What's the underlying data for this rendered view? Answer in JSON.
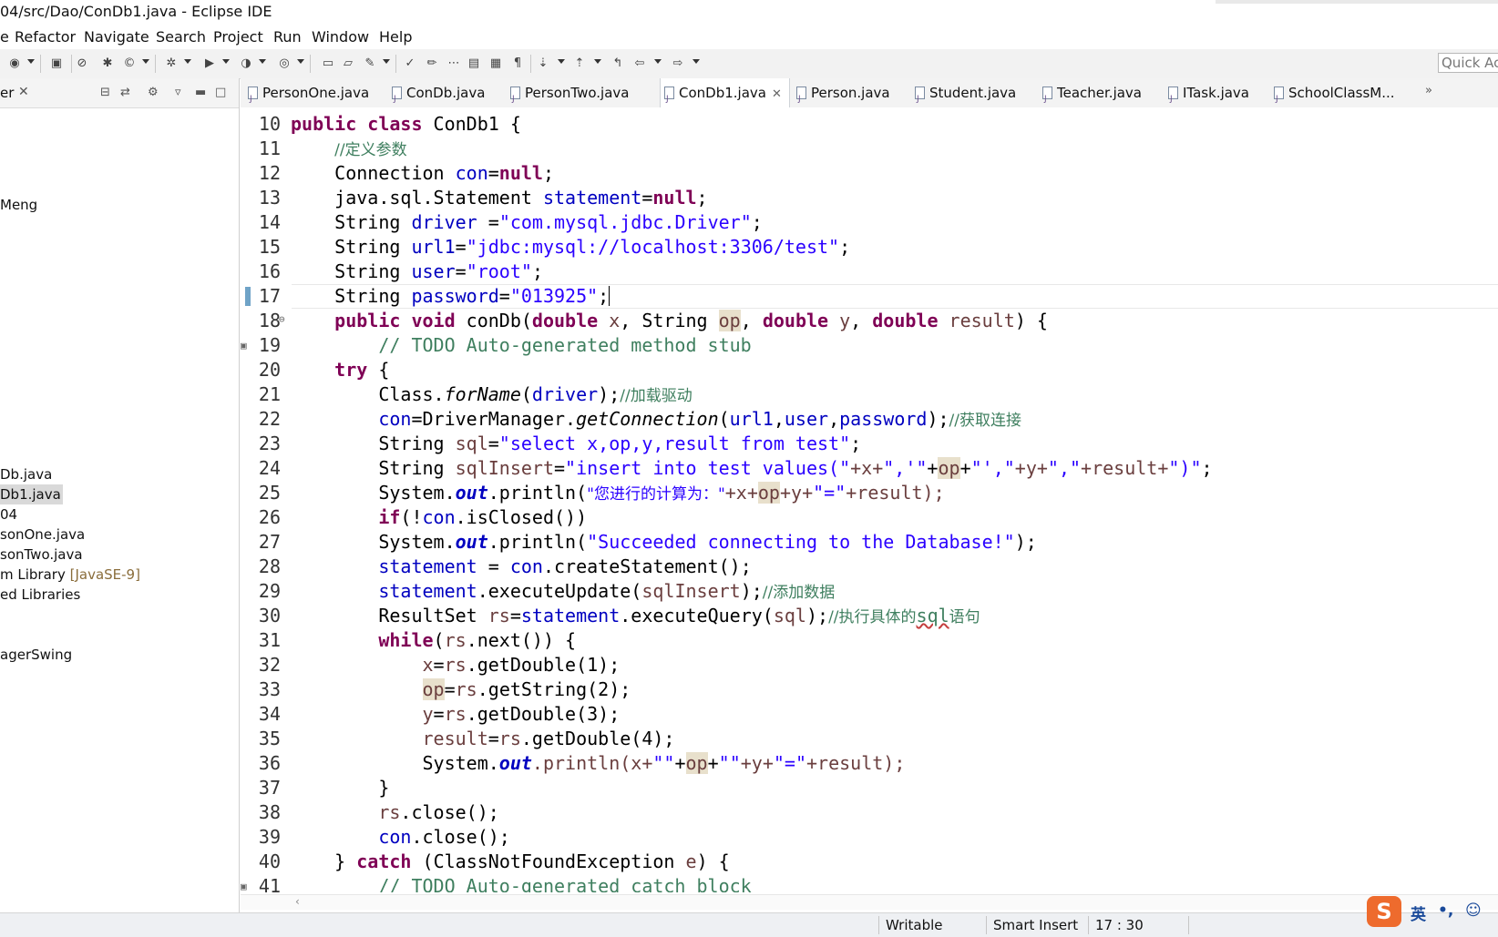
{
  "window": {
    "title": "04/src/Dao/ConDb1.java - Eclipse IDE"
  },
  "menu": [
    "e",
    "Refactor",
    "Navigate",
    "Search",
    "Project",
    "Run",
    "Window",
    "Help"
  ],
  "quick_access": {
    "label": "Quick Ac"
  },
  "explorer": {
    "tab_label": "er",
    "items": [
      {
        "label": "Meng"
      },
      {
        "label": "Db.java"
      },
      {
        "label": "Db1.java"
      },
      {
        "label": "04"
      },
      {
        "label": "sonOne.java"
      },
      {
        "label": "sonTwo.java"
      },
      {
        "label": "m Library ",
        "extra": "[JavaSE-9]"
      },
      {
        "label": "ed Libraries"
      },
      {
        "label": "agerSwing"
      }
    ]
  },
  "tabs": [
    {
      "label": "PersonOne.java"
    },
    {
      "label": "ConDb.java"
    },
    {
      "label": "PersonTwo.java"
    },
    {
      "label": "ConDb1.java",
      "active": true
    },
    {
      "label": "Person.java"
    },
    {
      "label": "Student.java"
    },
    {
      "label": "Teacher.java"
    },
    {
      "label": "ITask.java"
    },
    {
      "label": "SchoolClassM..."
    }
  ],
  "tabs_overflow": "»",
  "editor": {
    "line_numbers": [
      "10",
      "11",
      "12",
      "13",
      "14",
      "15",
      "16",
      "17",
      "18",
      "19",
      "20",
      "21",
      "22",
      "23",
      "24",
      "25",
      "26",
      "27",
      "28",
      "29",
      "30",
      "31",
      "32",
      "33",
      "34",
      "35",
      "36",
      "37",
      "38",
      "39",
      "40",
      "41"
    ],
    "code": {
      "l10": {
        "kw1": "public class",
        "rest": " ConDb1 {"
      },
      "l11": {
        "comment": "//定义参数"
      },
      "l12": {
        "type": "Connection ",
        "field": "con",
        "eq": "=",
        "kw": "null",
        "end": ";"
      },
      "l13": {
        "type": "java.sql.Statement ",
        "field": "statement",
        "eq": "=",
        "kw": "null",
        "end": ";"
      },
      "l14": {
        "type": "String ",
        "field": "driver",
        "eq": " =",
        "str": "\"com.mysql.jdbc.Driver\"",
        "end": ";"
      },
      "l15": {
        "type": "String ",
        "field": "url1",
        "eq": "=",
        "str": "\"jdbc:mysql://localhost:3306/test\"",
        "end": ";"
      },
      "l16": {
        "type": "String ",
        "field": "user",
        "eq": "=",
        "str": "\"root\"",
        "end": ";"
      },
      "l17": {
        "type": "String ",
        "field": "password",
        "eq": "=",
        "str": "\"013925\"",
        "end": ";"
      },
      "l18": {
        "kw1": "public void",
        "name": " conDb(",
        "kw_double": "double",
        "p1": " x",
        "c1": ", String ",
        "p2": "op",
        "c2": ", ",
        "p3": " y",
        "c3": ", ",
        "p4": " result",
        "end": ") {"
      },
      "l19": {
        "comment": "// TODO Auto-generated method stub"
      },
      "l20": {
        "kw": "try",
        "end": " {"
      },
      "l21": {
        "a": "Class.",
        "m": "forName",
        "b": "(",
        "field": "driver",
        "c": ");",
        "comment": "//加载驱动"
      },
      "l22": {
        "field": "con",
        "a": "=DriverManager.",
        "m": "getConnection",
        "b": "(",
        "f1": "url1",
        "c1": ",",
        "f2": "user",
        "c2": ",",
        "f3": "password",
        "c": ");",
        "comment": "//获取连接"
      },
      "l23": {
        "type": "String ",
        "var": "sql",
        "eq": "=",
        "str": "\"select x,op,y,result from test\"",
        "end": ";"
      },
      "l24": {
        "type": "String ",
        "var": "sqlInsert",
        "eq": "=",
        "s1": "\"insert into test values(\"",
        "v1": "+x+",
        "s2": "\",'\"",
        "v2": "+",
        "op": "op",
        "v3": "+",
        "s3": "\"',\"",
        "v4": "+y+",
        "s4": "\",\"",
        "v5": "+result+",
        "s5": "\")\"",
        "end": ";"
      },
      "l25": {
        "a": "System.",
        "sf": "out",
        "b": ".println(",
        "zh": "\"您进行的计算为：\"",
        "c": "+x+",
        "op": "op",
        "d": "+y+",
        "str": "\"=\"",
        "e": "+result);"
      },
      "l26": {
        "kw": "if",
        "a": "(!",
        "field": "con",
        "b": ".isClosed())"
      },
      "l27": {
        "a": "System.",
        "sf": "out",
        "b": ".println(",
        "str": "\"Succeeded connecting to the Database!\"",
        "c": ");"
      },
      "l28": {
        "field": "statement",
        "a": " = ",
        "field2": "con",
        "b": ".createStatement();"
      },
      "l29": {
        "field": "statement",
        "a": ".executeUpdate(",
        "var": "sqlInsert",
        "b": ");",
        "comment": "//添加数据"
      },
      "l30": {
        "a": "ResultSet ",
        "var": "rs",
        "b": "=",
        "field": "statement",
        "c": ".executeQuery(",
        "var2": "sql",
        "d": ");",
        "comment": "//执行具体的",
        "sq": "sql",
        "comment2": "语句"
      },
      "l31": {
        "kw": "while",
        "a": "(",
        "var": "rs",
        "b": ".next()) {"
      },
      "l32": {
        "var": "x",
        "a": "=",
        "var2": "rs",
        "b": ".getDouble(1);"
      },
      "l33": {
        "var": "op",
        "a": "=",
        "var2": "rs",
        "b": ".getString(2);"
      },
      "l34": {
        "var": "y",
        "a": "=",
        "var2": "rs",
        "b": ".getDouble(3);"
      },
      "l35": {
        "var": "result",
        "a": "=",
        "var2": "rs",
        "b": ".getDouble(4);"
      },
      "l36": {
        "a": "System.",
        "sf": "out",
        "b": ".println(x+",
        "s1": "\"\"",
        "c": "+",
        "op": "op",
        "d": "+",
        "s2": "\"\"",
        "e": "+y+",
        "s3": "\"=\"",
        "f": "+result);"
      },
      "l37": {
        "a": "}"
      },
      "l38": {
        "var": "rs",
        "a": ".close();"
      },
      "l39": {
        "field": "con",
        "a": ".close();"
      },
      "l40": {
        "a": "} ",
        "kw": "catch",
        "b": " (ClassNotFoundException ",
        "var": "e",
        "c": ") {"
      },
      "l41": {
        "comment": "// TODO Auto-generated catch block"
      }
    }
  },
  "status": {
    "writable": "Writable",
    "insert_mode": "Smart Insert",
    "position": "17 : 30"
  },
  "ime": {
    "logo": "S",
    "lang": "英",
    "punct": "•,",
    "icon": "☺"
  },
  "colors": {
    "keyword": "#7f0055",
    "string": "#2a00ff",
    "comment": "#3f7f5f",
    "field": "#0000c0",
    "local_var": "#6a3e3e",
    "occurrence": "#e8e0cc"
  }
}
